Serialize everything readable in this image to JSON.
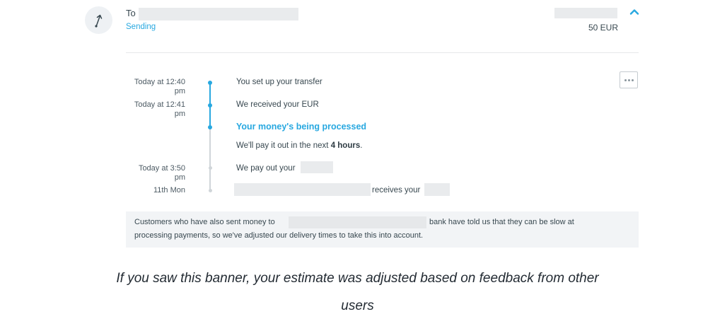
{
  "transfer": {
    "to_label": "To",
    "status": "Sending",
    "amount": "50 EUR"
  },
  "timeline": {
    "steps": [
      {
        "time_line1": "Today at 12:40",
        "time_line2": "pm",
        "text": "You set up your transfer",
        "state": "done"
      },
      {
        "time_line1": "Today at 12:41",
        "time_line2": "pm",
        "text": "We received your EUR",
        "state": "done"
      },
      {
        "time_line1": "",
        "time_line2": "",
        "text": "Your money's being processed",
        "state": "current",
        "detail_prefix": "We'll pay it out in the next",
        "detail_bold": "4 hours",
        "detail_suffix": "."
      },
      {
        "time_line1": "Today at 3:50",
        "time_line2": "pm",
        "text": "We pay out your",
        "state": "pending"
      },
      {
        "time_line1": "11th Mon",
        "time_line2": "",
        "text": "receives your",
        "state": "pending"
      }
    ]
  },
  "banner": {
    "line1_prefix": "Customers who have also sent money to",
    "line1_suffix": "bank have told us that they can be slow at",
    "line2": "processing payments, so we've adjusted our delivery times to take this into account."
  },
  "caption": {
    "line1": "If you saw this banner, your estimate was adjusted based on feedback from other",
    "line2": "users"
  },
  "colors": {
    "accent": "#28a8e0",
    "timeline_pending": "#d0d5d9",
    "redaction": "#e9ebed",
    "banner_bg": "#f2f4f6"
  },
  "icons": {
    "avatar": "arrow-up-right-icon",
    "collapse": "chevron-up-icon",
    "more": "more-dots-icon"
  }
}
